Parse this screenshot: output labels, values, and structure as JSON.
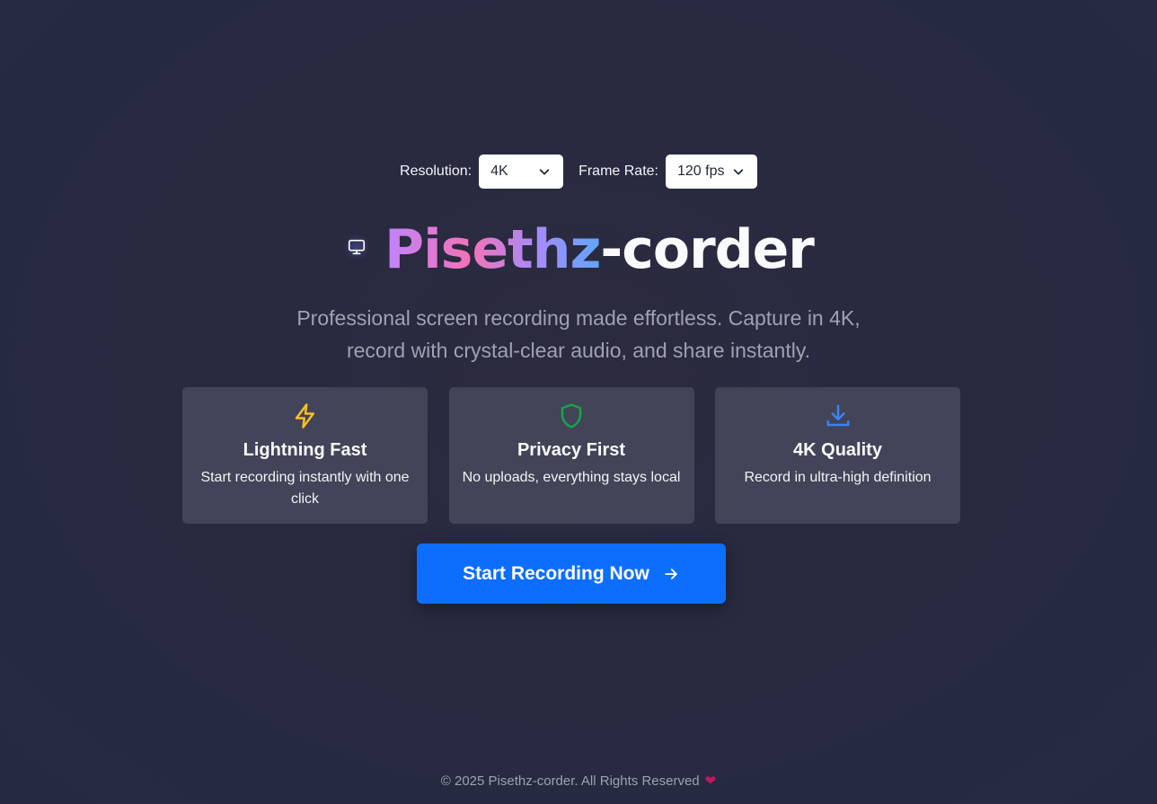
{
  "settings": {
    "resolution_label": "Resolution:",
    "resolution_value": "4K",
    "framerate_label": "Frame Rate:",
    "framerate_value": "120 fps"
  },
  "hero": {
    "title_highlight": "Pisethz",
    "title_rest": "-corder",
    "subtitle_line1": "Professional screen recording made effortless. Capture in 4K,",
    "subtitle_line2": "record with crystal-clear audio, and share instantly."
  },
  "features": [
    {
      "icon": "lightning-icon",
      "icon_color": "#fbbf24",
      "title": "Lightning Fast",
      "description": "Start recording instantly with one click"
    },
    {
      "icon": "shield-icon",
      "icon_color": "#16a34a",
      "title": "Privacy First",
      "description": "No uploads, everything stays local"
    },
    {
      "icon": "download-icon",
      "icon_color": "#3b82f6",
      "title": "4K Quality",
      "description": "Record in ultra-high definition"
    }
  ],
  "cta": {
    "label": "Start Recording Now",
    "color": "#0d6efd"
  },
  "footer": {
    "text": "© 2025 Pisethz-corder. All Rights Reserved",
    "heart": "❤"
  }
}
